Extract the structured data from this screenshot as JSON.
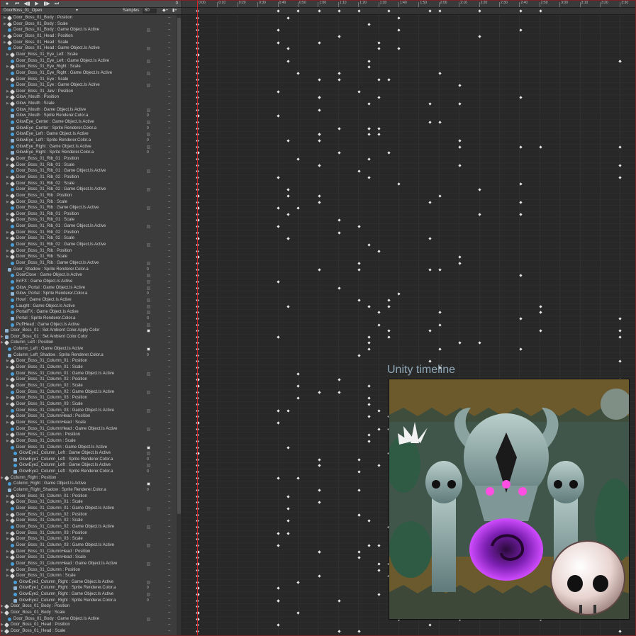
{
  "toolbar": {
    "buttons": [
      "rec",
      "first",
      "prev",
      "play",
      "next",
      "last"
    ],
    "frame_value": "0"
  },
  "clip": {
    "name": "DoorBoss_01_Open",
    "samples_label": "Samples",
    "samples_value": "60"
  },
  "ruler": {
    "ticks": [
      "0:00",
      "0:10",
      "0:20",
      "0:30",
      "0:40",
      "0:50",
      "1:00",
      "1:10",
      "1:20",
      "1:30",
      "1:40",
      "1:50",
      "2:00",
      "2:10",
      "2:20",
      "2:30",
      "2:40",
      "2:50",
      "3:00",
      "3:10",
      "3:20",
      "3:30"
    ]
  },
  "overlay": {
    "title": "Unity timeline"
  },
  "colors": {
    "playhead": "#d2242a",
    "accent_icon": "#4a9fd8",
    "panel_bg": "#3c3c3c",
    "grid_bg": "#282828",
    "frame_border": "#7a2326"
  },
  "properties": [
    {
      "label": "Door_Boss_01_Body : Position",
      "indent": 1,
      "icon": "pos",
      "value": "dash",
      "fold": true
    },
    {
      "label": "Door_Boss_01_Body : Scale",
      "indent": 1,
      "icon": "pos",
      "value": "dash",
      "fold": true
    },
    {
      "label": "Door_Boss_01_Body : Game Object.Is Active",
      "indent": 1,
      "icon": "go",
      "value": "off"
    },
    {
      "label": "Door_Boss_01_Head : Position",
      "indent": 1,
      "icon": "pos",
      "value": "dash",
      "fold": true
    },
    {
      "label": "Door_Boss_01_Head : Scale",
      "indent": 1,
      "icon": "pos",
      "value": "dash",
      "fold": true
    },
    {
      "label": "Door_Boss_01_Head : Game Object.Is Active",
      "indent": 1,
      "icon": "go",
      "value": "off"
    },
    {
      "label": "Door_Boss_01_Eye_Left : Scale",
      "indent": 2,
      "icon": "pos",
      "value": "dash",
      "fold": true
    },
    {
      "label": "Door_Boss_01_Eye_Left : Game Object.Is Active",
      "indent": 2,
      "icon": "go",
      "value": "off"
    },
    {
      "label": "Door_Boss_01_Eye_Right : Scale",
      "indent": 2,
      "icon": "pos",
      "value": "dash",
      "fold": true
    },
    {
      "label": "Door_Boss_01_Eye_Right : Game Object.Is Active",
      "indent": 2,
      "icon": "go",
      "value": "off"
    },
    {
      "label": "Door_Boss_01_Eye : Scale",
      "indent": 2,
      "icon": "pos",
      "value": "dash",
      "fold": true
    },
    {
      "label": "Door_Boss_01_Eye : Game Object.Is Active",
      "indent": 2,
      "icon": "go",
      "value": "off"
    },
    {
      "label": "Door_Boss_01_Jaw : Position",
      "indent": 2,
      "icon": "pos",
      "value": "dash",
      "fold": true
    },
    {
      "label": "Glow_Mouth : Position",
      "indent": 2,
      "icon": "pos",
      "value": "dash",
      "fold": true
    },
    {
      "label": "Glow_Mouth : Scale",
      "indent": 2,
      "icon": "pos",
      "value": "dash",
      "fold": true
    },
    {
      "label": "Glow_Mouth : Game Object.Is Active",
      "indent": 2,
      "icon": "go",
      "value": "off"
    },
    {
      "label": "Glow_Mouth : Sprite Renderer.Color.a",
      "indent": 2,
      "icon": "sr",
      "value": "0"
    },
    {
      "label": "GlowEye_Center : Game Object.Is Active",
      "indent": 2,
      "icon": "go",
      "value": "off"
    },
    {
      "label": "GlowEye_Center : Sprite Renderer.Color.a",
      "indent": 2,
      "icon": "sr",
      "value": "0"
    },
    {
      "label": "GlowEye_Left : Game Object.Is Active",
      "indent": 2,
      "icon": "go",
      "value": "off"
    },
    {
      "label": "GlowEye_Left : Sprite Renderer.Color.a",
      "indent": 2,
      "icon": "sr",
      "value": "0"
    },
    {
      "label": "GlowEye_Right : Game Object.Is Active",
      "indent": 2,
      "icon": "go",
      "value": "off"
    },
    {
      "label": "GlowEye_Right : Sprite Renderer.Color.a",
      "indent": 2,
      "icon": "sr",
      "value": "0"
    },
    {
      "label": "Door_Boss_01_Rib_01 : Position",
      "indent": 2,
      "icon": "pos",
      "value": "dash",
      "fold": true
    },
    {
      "label": "Door_Boss_01_Rib_01 : Scale",
      "indent": 2,
      "icon": "pos",
      "value": "dash",
      "fold": true
    },
    {
      "label": "Door_Boss_01_Rib_01 : Game Object.Is Active",
      "indent": 2,
      "icon": "go",
      "value": "off"
    },
    {
      "label": "Door_Boss_01_Rib_02 : Position",
      "indent": 2,
      "icon": "pos",
      "value": "dash",
      "fold": true
    },
    {
      "label": "Door_Boss_01_Rib_02 : Scale",
      "indent": 2,
      "icon": "pos",
      "value": "dash",
      "fold": true
    },
    {
      "label": "Door_Boss_01_Rib_02 : Game Object.Is Active",
      "indent": 2,
      "icon": "go",
      "value": "off"
    },
    {
      "label": "Door_Boss_01_Rib : Position",
      "indent": 2,
      "icon": "pos",
      "value": "dash",
      "fold": true
    },
    {
      "label": "Door_Boss_01_Rib : Scale",
      "indent": 2,
      "icon": "pos",
      "value": "dash",
      "fold": true
    },
    {
      "label": "Door_Boss_01_Rib : Game Object.Is Active",
      "indent": 2,
      "icon": "go",
      "value": "off"
    },
    {
      "label": "Door_Boss_01_Rib_01 : Position",
      "indent": 2,
      "icon": "pos",
      "value": "dash",
      "fold": true
    },
    {
      "label": "Door_Boss_01_Rib_01 : Scale",
      "indent": 2,
      "icon": "pos",
      "value": "dash",
      "fold": true
    },
    {
      "label": "Door_Boss_01_Rib_01 : Game Object.Is Active",
      "indent": 2,
      "icon": "go",
      "value": "off"
    },
    {
      "label": "Door_Boss_01_Rib_02 : Position",
      "indent": 2,
      "icon": "pos",
      "value": "dash",
      "fold": true
    },
    {
      "label": "Door_Boss_01_Rib_02 : Scale",
      "indent": 2,
      "icon": "pos",
      "value": "dash",
      "fold": true
    },
    {
      "label": "Door_Boss_01_Rib_02 : Game Object.Is Active",
      "indent": 2,
      "icon": "go",
      "value": "off"
    },
    {
      "label": "Door_Boss_01_Rib : Position",
      "indent": 2,
      "icon": "pos",
      "value": "dash",
      "fold": true
    },
    {
      "label": "Door_Boss_01_Rib : Scale",
      "indent": 2,
      "icon": "pos",
      "value": "dash",
      "fold": true
    },
    {
      "label": "Door_Boss_01_Rib : Game Object.Is Active",
      "indent": 2,
      "icon": "go",
      "value": "off"
    },
    {
      "label": "Door_Shadow : Sprite Renderer.Color.a",
      "indent": 1,
      "icon": "sr",
      "value": "0"
    },
    {
      "label": "DoorClose : Game Object.Is Active",
      "indent": 2,
      "icon": "go",
      "value": "off"
    },
    {
      "label": "EnFX : Game Object.Is Active",
      "indent": 2,
      "icon": "go",
      "value": "off"
    },
    {
      "label": "Glow_Portal : Game Object.Is Active",
      "indent": 2,
      "icon": "go",
      "value": "off"
    },
    {
      "label": "Glow_Portal : Sprite Renderer.Color.a",
      "indent": 2,
      "icon": "sr",
      "value": "0"
    },
    {
      "label": "Howl : Game Object.Is Active",
      "indent": 2,
      "icon": "go",
      "value": "off"
    },
    {
      "label": "Laught : Game Object.Is Active",
      "indent": 2,
      "icon": "go",
      "value": "off"
    },
    {
      "label": "PortalFX : Game Object.Is Active",
      "indent": 2,
      "icon": "go",
      "value": "off"
    },
    {
      "label": "Portal : Sprite Renderer.Color.a",
      "indent": 2,
      "icon": "sr",
      "value": "0"
    },
    {
      "label": "PuffHead : Game Object.Is Active",
      "indent": 2,
      "icon": "go",
      "value": "off"
    },
    {
      "label": "Door_Boss_01 : Set Ambient Color.Apply Color",
      "indent": 0,
      "icon": "sr",
      "value": "on"
    },
    {
      "label": "Door_Boss_01 : Set Ambient Color.Color",
      "indent": 0,
      "icon": "sr",
      "value": "dash",
      "fold": true
    },
    {
      "label": "Column_Left : Position",
      "indent": 0,
      "icon": "pos",
      "value": "dash",
      "fold": true
    },
    {
      "label": "Column_Left : Game Object.Is Active",
      "indent": 1,
      "icon": "go",
      "value": "on"
    },
    {
      "label": "Column_Left_Shadow : Sprite Renderer.Color.a",
      "indent": 1,
      "icon": "sr",
      "value": "0"
    },
    {
      "label": "Door_Boss_01_Column_01 : Position",
      "indent": 2,
      "icon": "pos",
      "value": "dash",
      "fold": true
    },
    {
      "label": "Door_Boss_01_Column_01 : Scale",
      "indent": 2,
      "icon": "pos",
      "value": "dash",
      "fold": true
    },
    {
      "label": "Door_Boss_01_Column_01 : Game Object.Is Active",
      "indent": 2,
      "icon": "go",
      "value": "off"
    },
    {
      "label": "Door_Boss_01_Column_02 : Position",
      "indent": 2,
      "icon": "pos",
      "value": "dash",
      "fold": true
    },
    {
      "label": "Door_Boss_01_Column_02 : Scale",
      "indent": 2,
      "icon": "pos",
      "value": "dash",
      "fold": true
    },
    {
      "label": "Door_Boss_01_Column_02 : Game Object.Is Active",
      "indent": 2,
      "icon": "go",
      "value": "off"
    },
    {
      "label": "Door_Boss_01_Column_03 : Position",
      "indent": 2,
      "icon": "pos",
      "value": "dash",
      "fold": true
    },
    {
      "label": "Door_Boss_01_Column_03 : Scale",
      "indent": 2,
      "icon": "pos",
      "value": "dash",
      "fold": true
    },
    {
      "label": "Door_Boss_01_Column_03 : Game Object.Is Active",
      "indent": 2,
      "icon": "go",
      "value": "off"
    },
    {
      "label": "Door_Boss_01_ColumnHead : Position",
      "indent": 2,
      "icon": "pos",
      "value": "dash",
      "fold": true
    },
    {
      "label": "Door_Boss_01_ColumnHead : Scale",
      "indent": 2,
      "icon": "pos",
      "value": "dash",
      "fold": true
    },
    {
      "label": "Door_Boss_01_ColumnHead : Game Object.Is Active",
      "indent": 2,
      "icon": "go",
      "value": "off"
    },
    {
      "label": "Door_Boss_01_Column : Position",
      "indent": 2,
      "icon": "pos",
      "value": "dash",
      "fold": true
    },
    {
      "label": "Door_Boss_01_Column : Scale",
      "indent": 2,
      "icon": "pos",
      "value": "dash",
      "fold": true
    },
    {
      "label": "Door_Boss_01_Column : Game Object.Is Active",
      "indent": 2,
      "icon": "go",
      "value": "on"
    },
    {
      "label": "GlowEye1_Column_Left : Game Object.Is Active",
      "indent": 3,
      "icon": "go",
      "value": "off"
    },
    {
      "label": "GlowEye1_Column_Left : Sprite Renderer.Color.a",
      "indent": 3,
      "icon": "sr",
      "value": "0"
    },
    {
      "label": "GlowEye2_Column_Left : Game Object.Is Active",
      "indent": 3,
      "icon": "go",
      "value": "off"
    },
    {
      "label": "GlowEye2_Column_Left : Sprite Renderer.Color.a",
      "indent": 3,
      "icon": "sr",
      "value": "0"
    },
    {
      "label": "Column_Right : Position",
      "indent": 0,
      "icon": "pos",
      "value": "dash",
      "fold": true
    },
    {
      "label": "Column_Right : Game Object.Is Active",
      "indent": 1,
      "icon": "go",
      "value": "on"
    },
    {
      "label": "Column_Right_Shadow : Sprite Renderer.Color.a",
      "indent": 1,
      "icon": "sr",
      "value": "0"
    },
    {
      "label": "Door_Boss_01_Column_01 : Position",
      "indent": 2,
      "icon": "pos",
      "value": "dash",
      "fold": true
    },
    {
      "label": "Door_Boss_01_Column_01 : Scale",
      "indent": 2,
      "icon": "pos",
      "value": "dash",
      "fold": true
    },
    {
      "label": "Door_Boss_01_Column_01 : Game Object.Is Active",
      "indent": 2,
      "icon": "go",
      "value": "off"
    },
    {
      "label": "Door_Boss_01_Column_02 : Position",
      "indent": 2,
      "icon": "pos",
      "value": "dash",
      "fold": true
    },
    {
      "label": "Door_Boss_01_Column_02 : Scale",
      "indent": 2,
      "icon": "pos",
      "value": "dash",
      "fold": true
    },
    {
      "label": "Door_Boss_01_Column_02 : Game Object.Is Active",
      "indent": 2,
      "icon": "go",
      "value": "off"
    },
    {
      "label": "Door_Boss_01_Column_03 : Position",
      "indent": 2,
      "icon": "pos",
      "value": "dash",
      "fold": true
    },
    {
      "label": "Door_Boss_01_Column_03 : Scale",
      "indent": 2,
      "icon": "pos",
      "value": "dash",
      "fold": true
    },
    {
      "label": "Door_Boss_01_Column_03 : Game Object.Is Active",
      "indent": 2,
      "icon": "go",
      "value": "off"
    },
    {
      "label": "Door_Boss_01_ColumnHead : Position",
      "indent": 2,
      "icon": "pos",
      "value": "dash",
      "fold": true
    },
    {
      "label": "Door_Boss_01_ColumnHead : Scale",
      "indent": 2,
      "icon": "pos",
      "value": "dash",
      "fold": true
    },
    {
      "label": "Door_Boss_01_ColumnHead : Game Object.Is Active",
      "indent": 2,
      "icon": "go",
      "value": "off"
    },
    {
      "label": "Door_Boss_01_Column : Position",
      "indent": 2,
      "icon": "pos",
      "value": "dash",
      "fold": true
    },
    {
      "label": "Door_Boss_01_Column : Scale",
      "indent": 2,
      "icon": "pos",
      "value": "dash",
      "fold": true
    },
    {
      "label": "GlowEye1_Column_Right : Game Object.Is Active",
      "indent": 3,
      "icon": "go",
      "value": "off"
    },
    {
      "label": "GlowEye1_Column_Right : Sprite Renderer.Color.a",
      "indent": 3,
      "icon": "sr",
      "value": "0"
    },
    {
      "label": "GlowEye2_Column_Right : Game Object.Is Active",
      "indent": 3,
      "icon": "go",
      "value": "off"
    },
    {
      "label": "GlowEye2_Column_Right : Sprite Renderer.Color.a",
      "indent": 3,
      "icon": "sr",
      "value": "0"
    },
    {
      "label": "Door_Boss_01_Body : Position",
      "indent": 0,
      "icon": "pos",
      "value": "dash",
      "fold": true
    },
    {
      "label": "Door_Boss_01_Body : Scale",
      "indent": 0,
      "icon": "pos",
      "value": "dash",
      "fold": true
    },
    {
      "label": "Door_Boss_01_Body : Game Object.Is Active",
      "indent": 1,
      "icon": "go",
      "value": "off"
    },
    {
      "label": "Door_Boss_01_Head : Position",
      "indent": 0,
      "icon": "pos",
      "value": "dash",
      "fold": true
    },
    {
      "label": "Door_Boss_01_Head : Scale",
      "indent": 0,
      "icon": "pos",
      "value": "dash",
      "fold": true
    }
  ]
}
